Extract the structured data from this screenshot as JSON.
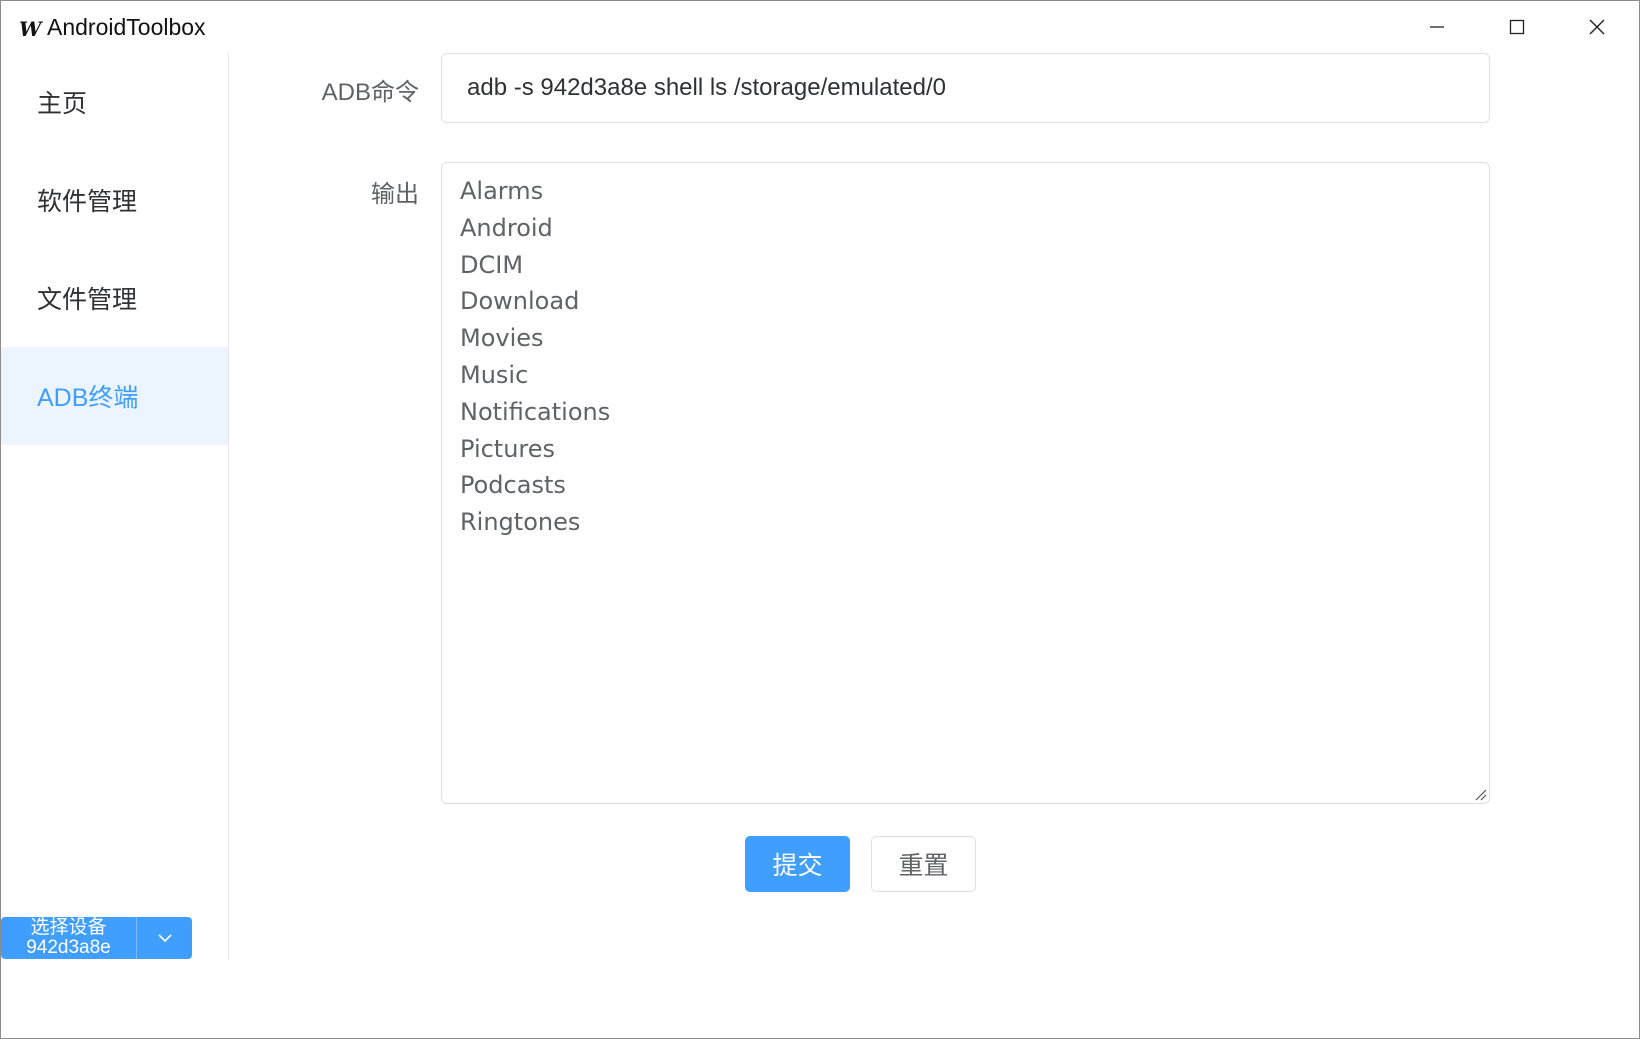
{
  "window": {
    "icon_text": "W",
    "title": "AndroidToolbox"
  },
  "sidebar": {
    "items": [
      {
        "label": "主页"
      },
      {
        "label": "软件管理"
      },
      {
        "label": "文件管理"
      },
      {
        "label": "ADB终端",
        "active": true
      }
    ],
    "device_select": {
      "label": "选择设备",
      "device": "942d3a8e"
    }
  },
  "form": {
    "command_label": "ADB命令",
    "command_value": "adb -s 942d3a8e shell ls /storage/emulated/0",
    "output_label": "输出",
    "output_lines": [
      "Alarms",
      "Android",
      "DCIM",
      "Download",
      "Movies",
      "Music",
      "Notifications",
      "Pictures",
      "Podcasts",
      "Ringtones"
    ],
    "submit_label": "提交",
    "reset_label": "重置"
  },
  "colors": {
    "accent": "#409eff",
    "active_bg": "#ecf5ff"
  }
}
